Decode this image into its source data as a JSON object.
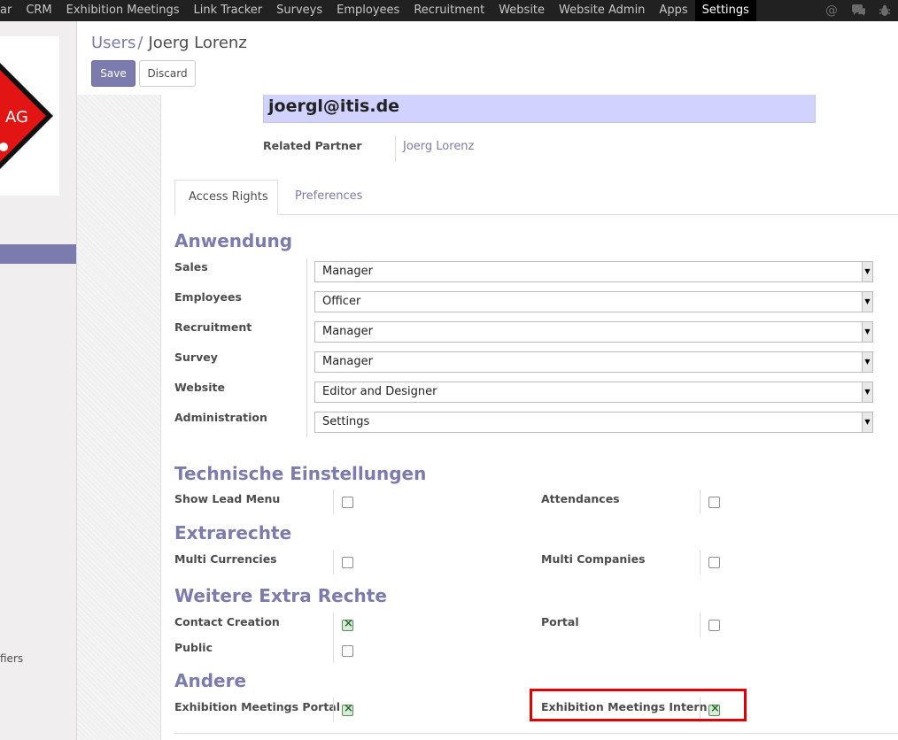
{
  "topnav": {
    "items": [
      "ar",
      "CRM",
      "Exhibition Meetings",
      "Link Tracker",
      "Surveys",
      "Employees",
      "Recruitment",
      "Website",
      "Website Admin",
      "Apps",
      "Settings"
    ],
    "active": "Settings",
    "icons": [
      "at-icon",
      "chat-icon",
      "bug-icon"
    ]
  },
  "sidebar": {
    "partial_text": "fiers",
    "logo_text": "AG"
  },
  "breadcrumb": {
    "parent": "Users",
    "separator": "/",
    "current": "Joerg Lorenz"
  },
  "buttons": {
    "save": "Save",
    "discard": "Discard"
  },
  "user": {
    "email": "joergl@itis.de",
    "related_partner_label": "Related Partner",
    "related_partner_value": "Joerg Lorenz"
  },
  "tabs": [
    "Access Rights",
    "Preferences"
  ],
  "groups": {
    "anwendung": {
      "title": "Anwendung",
      "fields": [
        {
          "label": "Sales",
          "value": "Manager"
        },
        {
          "label": "Employees",
          "value": "Officer"
        },
        {
          "label": "Recruitment",
          "value": "Manager"
        },
        {
          "label": "Survey",
          "value": "Manager"
        },
        {
          "label": "Website",
          "value": "Editor and Designer"
        },
        {
          "label": "Administration",
          "value": "Settings"
        }
      ]
    },
    "technische": {
      "title": "Technische Einstellungen",
      "fields": [
        {
          "label": "Show Lead Menu",
          "checked": false
        },
        {
          "label": "Attendances",
          "checked": false
        }
      ]
    },
    "extrarechte": {
      "title": "Extrarechte",
      "fields": [
        {
          "label": "Multi Currencies",
          "checked": false
        },
        {
          "label": "Multi Companies",
          "checked": false
        }
      ]
    },
    "weitere": {
      "title": "Weitere Extra Rechte",
      "fields": [
        {
          "label": "Contact Creation",
          "checked": true
        },
        {
          "label": "Portal",
          "checked": false
        },
        {
          "label": "Public",
          "checked": false
        }
      ]
    },
    "andere": {
      "title": "Andere",
      "fields": [
        {
          "label": "Exhibition Meetings Portal",
          "checked": true
        },
        {
          "label": "Exhibition Meetings Intern",
          "checked": true
        }
      ]
    }
  },
  "colors": {
    "accent": "#7c7bad",
    "topbar": "#212121",
    "highlight": "#e20000",
    "email_bg": "#d2d2ff"
  }
}
